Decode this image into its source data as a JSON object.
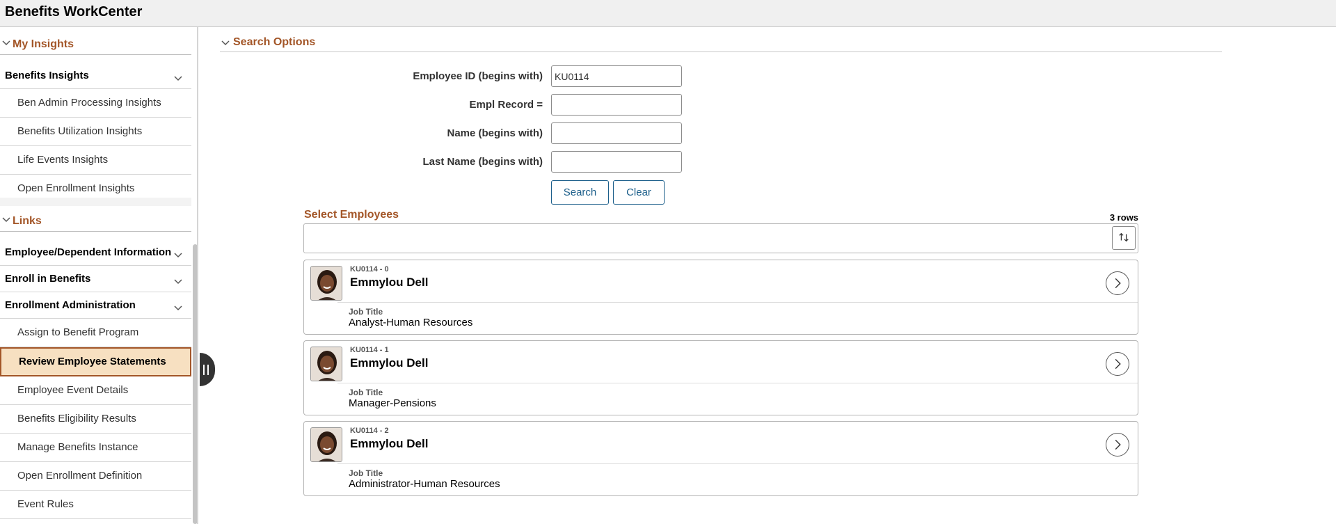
{
  "app": {
    "title": "Benefits WorkCenter"
  },
  "sidebar": {
    "my_insights": {
      "label": "My Insights",
      "benefits_insights": {
        "label": "Benefits Insights",
        "items": [
          {
            "label": "Ben Admin Processing Insights"
          },
          {
            "label": "Benefits Utilization Insights"
          },
          {
            "label": "Life Events Insights"
          },
          {
            "label": "Open Enrollment Insights"
          }
        ]
      }
    },
    "links": {
      "label": "Links",
      "employee_dependent": {
        "label": "Employee/Dependent Information"
      },
      "enroll": {
        "label": "Enroll in Benefits"
      },
      "enrollment_admin": {
        "label": "Enrollment Administration",
        "items": [
          {
            "label": "Assign to Benefit Program"
          },
          {
            "label": "Review Employee Statements",
            "active": true
          },
          {
            "label": "Employee Event Details"
          },
          {
            "label": "Benefits Eligibility Results"
          },
          {
            "label": "Manage Benefits Instance"
          },
          {
            "label": "Open Enrollment Definition"
          },
          {
            "label": "Event Rules"
          }
        ]
      }
    }
  },
  "search_options": {
    "title": "Search Options",
    "fields": [
      {
        "label": "Employee ID (begins with)",
        "value": "KU0114"
      },
      {
        "label": "Empl Record =",
        "value": ""
      },
      {
        "label": "Name (begins with)",
        "value": ""
      },
      {
        "label": "Last Name (begins with)",
        "value": ""
      }
    ],
    "search_label": "Search",
    "clear_label": "Clear"
  },
  "results": {
    "title": "Select Employees",
    "row_count": "3 rows",
    "employees": [
      {
        "id": "KU0114 - 0",
        "name": "Emmylou Dell",
        "job_title_label": "Job Title",
        "job_title": "Analyst-Human Resources"
      },
      {
        "id": "KU0114 - 1",
        "name": "Emmylou Dell",
        "job_title_label": "Job Title",
        "job_title": "Manager-Pensions"
      },
      {
        "id": "KU0114 - 2",
        "name": "Emmylou Dell",
        "job_title_label": "Job Title",
        "job_title": "Administrator-Human Resources"
      }
    ]
  },
  "colors": {
    "accent": "#a35628",
    "link": "#1b5e8a",
    "active_bg": "#f7e0c1"
  },
  "icons": [
    "chevron-down-icon",
    "sort-icon",
    "chevron-right-icon",
    "splitter-icon"
  ]
}
